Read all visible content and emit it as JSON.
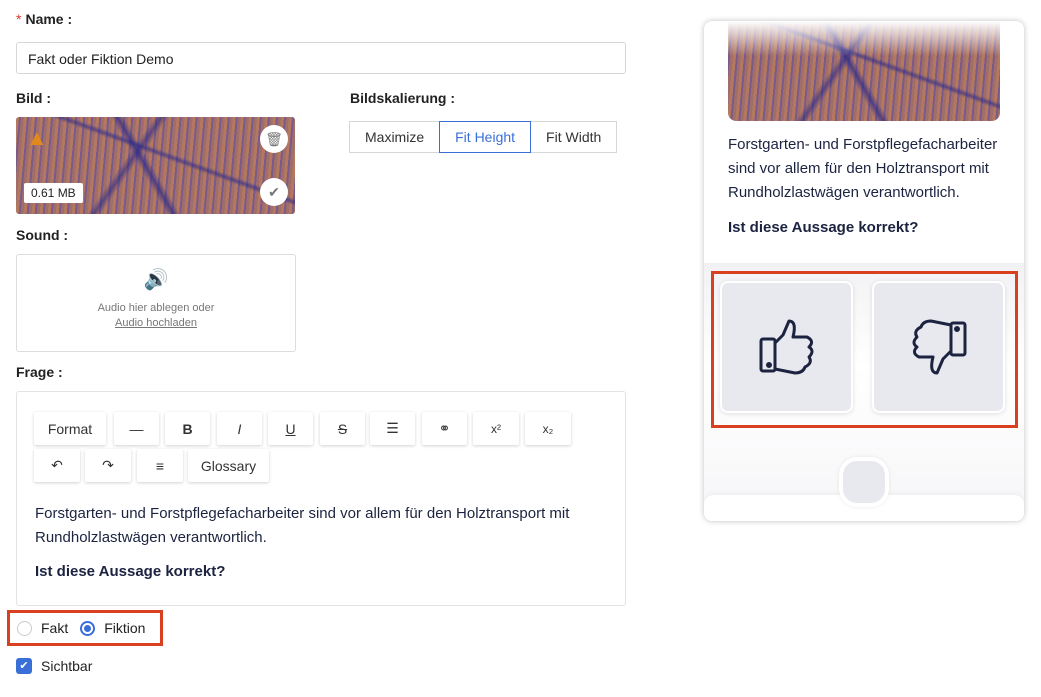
{
  "form": {
    "name_label": "Name",
    "name_value": "Fakt oder Fiktion Demo",
    "image_label": "Bild",
    "image_size": "0.61 MB",
    "scaling_label": "Bildskalierung",
    "scaling_options": [
      "Maximize",
      "Fit Height",
      "Fit Width"
    ],
    "scaling_selected": "Fit Height",
    "sound_label": "Sound",
    "sound_drop_text": "Audio hier ablegen oder",
    "sound_upload_link": "Audio hochladen",
    "question_label": "Frage",
    "toolbar": [
      "Format",
      "—",
      "B",
      "I",
      "U",
      "S",
      "list",
      "link",
      "x²",
      "x₂",
      "undo",
      "redo",
      "align",
      "Glossary"
    ],
    "question_text": "Forstgarten- und Forstpflegefacharbeiter sind vor allem für den Holztransport mit Rundholzlastwägen verantwortlich.",
    "question_prompt": "Ist diese Aussage korrekt?",
    "answer_options": [
      "Fakt",
      "Fiktion"
    ],
    "answer_selected": "Fiktion",
    "visible_label": "Sichtbar",
    "visible_checked": true
  },
  "preview": {
    "text": "Forstgarten- und Forstpflegefacharbeiter sind vor allem für den Holztransport mit Rundholzlastwägen verantwortlich.",
    "prompt": "Ist diese Aussage korrekt?",
    "buttons": [
      "thumbs-up-icon",
      "thumbs-down-icon"
    ]
  },
  "colors": {
    "accent": "#3a6fd8",
    "highlight": "#d8401f",
    "warning": "#e08a1e"
  }
}
